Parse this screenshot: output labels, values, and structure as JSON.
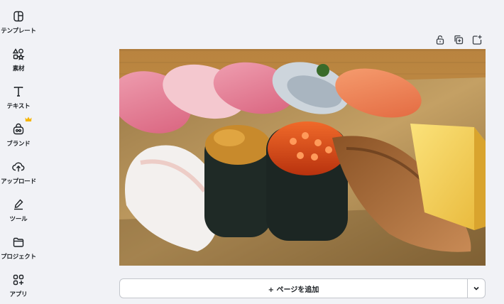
{
  "sidebar": {
    "items": [
      {
        "label": "テンプレート",
        "icon": "template-icon"
      },
      {
        "label": "素材",
        "icon": "elements-icon"
      },
      {
        "label": "テキスト",
        "icon": "text-icon"
      },
      {
        "label": "ブランド",
        "icon": "brand-icon"
      },
      {
        "label": "アップロード",
        "icon": "upload-icon"
      },
      {
        "label": "ツール",
        "icon": "tools-icon"
      },
      {
        "label": "プロジェクト",
        "icon": "projects-icon"
      },
      {
        "label": "アプリ",
        "icon": "apps-icon"
      }
    ],
    "badge_color": "#f5b400"
  },
  "toolbar": {
    "icons": [
      "lock-icon",
      "duplicate-icon",
      "add-page-icon"
    ]
  },
  "canvas": {
    "image": "sushi-platter-photo"
  },
  "add_page": {
    "label": "+ ページを追加",
    "more_icon": "chevron-down-icon"
  }
}
